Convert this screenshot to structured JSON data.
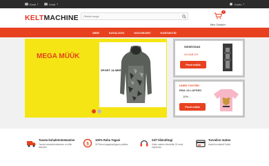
{
  "topbar": {
    "language": "Eesti",
    "currency": "Eesti",
    "account": "Konto"
  },
  "header": {
    "logo_part1": "KELT",
    "logo_part2": "MACHINE",
    "search_placeholder": "Otsida tooge",
    "cart_badge": "0",
    "cart_label": "Minu Ostukorv"
  },
  "nav": {
    "items": [
      "MEIE",
      "KATALOOG",
      "SOOVIKORV",
      "KONTAKTID"
    ]
  },
  "hero": {
    "title": "MEGA MÜÜK",
    "product_caption": "SPORT JA MEES",
    "slides": 2,
    "active_slide": 1
  },
  "side_top": {
    "heading": "SISSEOSAD",
    "price": "ALGAB 8 €",
    "button": "Poed müük"
  },
  "side_bottom": {
    "heading": "UUED TOOTED",
    "subheading": "EMA JA LAPSED",
    "discount": "10% -",
    "button": "Poed müük"
  },
  "features": [
    {
      "icon": "truck-icon",
      "title": "Tasuta kohaletoimetamine",
      "desc": "Tasuta kohaletoimetamine on kõik Machine"
    },
    {
      "icon": "money-back-icon",
      "title": "100% Raha Tagasi",
      "desc": "30 Päeva tagastusõiguse poliitika"
    },
    {
      "icon": "headset-icon",
      "title": "24/7 klienditugi",
      "desc": "Video mature klienditeli 24 tundi ööpäevas"
    },
    {
      "icon": "secure-payment-icon",
      "title": "Turvaline makse",
      "desc": "Avaldi turvaliselt Sobid"
    }
  ],
  "colors": {
    "accent": "#e8411f",
    "hero_bg": "#f5e514",
    "topbar": "#2b2b2b"
  }
}
